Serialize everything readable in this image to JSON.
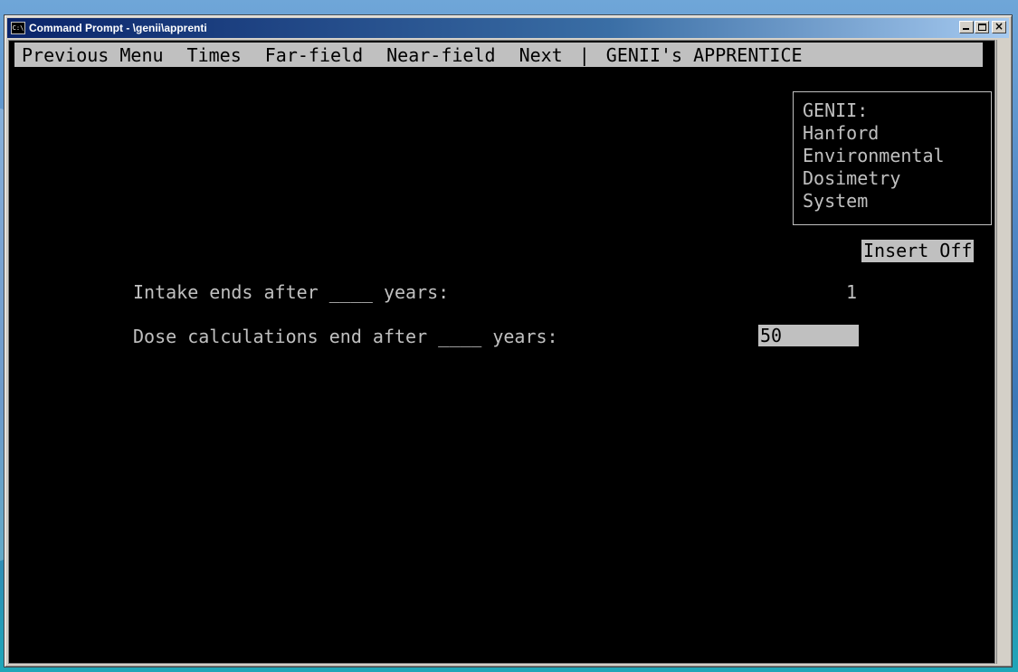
{
  "window": {
    "title": "Command Prompt - \\genii\\apprenti",
    "minimize_glyph": "",
    "close_glyph": "×"
  },
  "menubar": {
    "items": [
      "Previous Menu",
      "Times",
      "Far-field",
      "Near-field",
      "Next"
    ],
    "separator": "|",
    "app_title": "GENII's APPRENTICE"
  },
  "info_box": {
    "lines": [
      "GENII:",
      "Hanford",
      "Environmental",
      "Dosimetry",
      "System"
    ]
  },
  "status": {
    "insert": "Insert Off"
  },
  "fields": [
    {
      "label": "Intake ends after ____ years:",
      "value": "1"
    },
    {
      "label": "Dose calculations end after ____ years:",
      "value": "50"
    }
  ],
  "colors": {
    "console_bg": "#000000",
    "console_fg": "#c0c0c0",
    "menubar_bg": "#c0c0c0",
    "titlebar": "#0a246a"
  }
}
